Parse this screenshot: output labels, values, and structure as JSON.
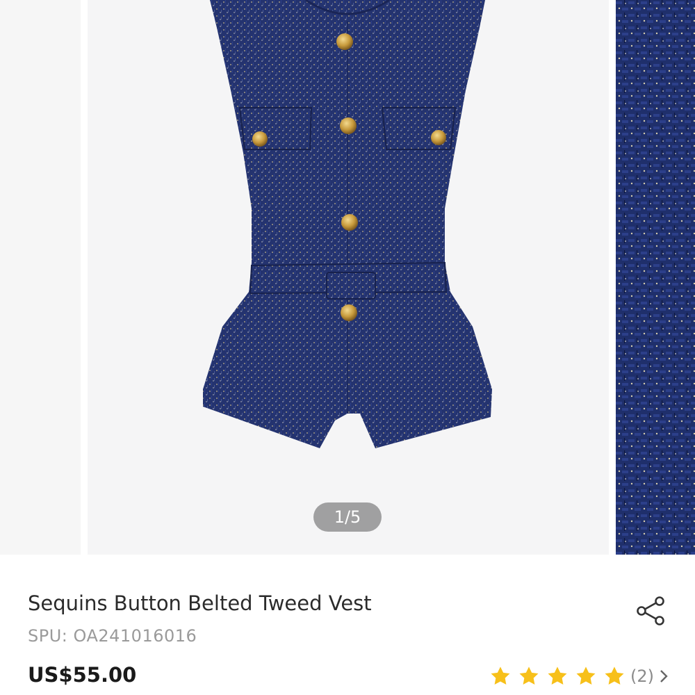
{
  "carousel": {
    "current_page": "1/5",
    "image_alt": "Navy tweed vest with gold buttons and belt"
  },
  "product": {
    "title": "Sequins Button Belted Tweed Vest",
    "spu": "SPU: OA241016016",
    "price": "US$55.00"
  },
  "rating": {
    "stars": 5,
    "count_label": "(2)",
    "star_color": "#f7c01a"
  },
  "icons": {
    "share": "share-icon",
    "chevron": "chevron-right-icon"
  }
}
